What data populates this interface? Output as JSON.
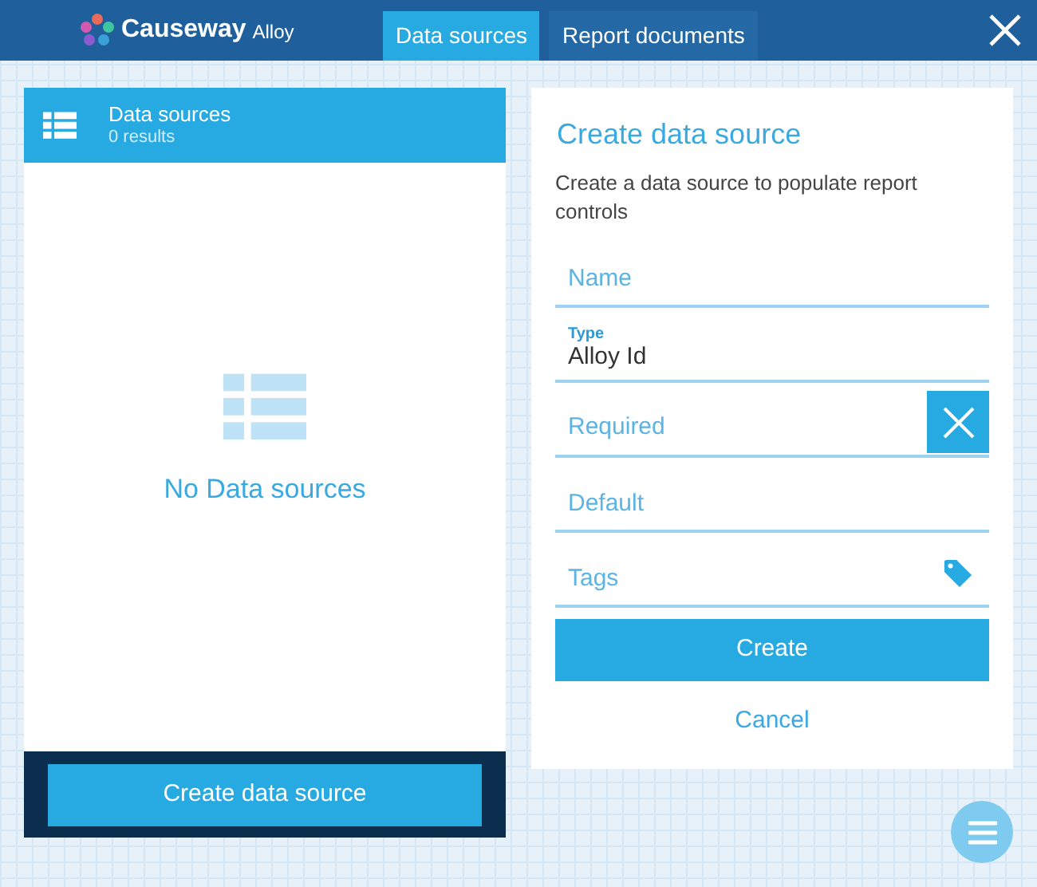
{
  "header": {
    "brand": "Causeway",
    "product": "Alloy",
    "tabs": [
      {
        "label": "Data sources",
        "selected": true
      },
      {
        "label": "Report documents",
        "selected": false
      }
    ]
  },
  "list_panel": {
    "title": "Data sources",
    "count": "0 results",
    "empty_text": "No Data sources",
    "button": "Create data source"
  },
  "form": {
    "title": "Create data source",
    "description": "Create a data source to populate report controls",
    "fields": [
      {
        "kind": "text",
        "placeholder": "Name"
      },
      {
        "kind": "text",
        "label": "Type",
        "value": "Alloy Id"
      },
      {
        "kind": "toggle",
        "label": "Required",
        "on": false
      },
      {
        "kind": "text",
        "placeholder": "Default"
      },
      {
        "kind": "tags",
        "placeholder": "Tags"
      }
    ],
    "submit": "Create",
    "cancel": "Cancel"
  }
}
